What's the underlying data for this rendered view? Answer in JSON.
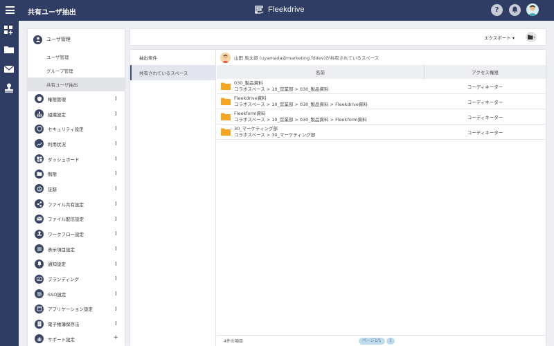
{
  "header": {
    "title": "共有ユーザ抽出",
    "brand": "Fleekdrive",
    "help_label": "?"
  },
  "menu": {
    "section_title": "ユーザ管理",
    "sub_items": [
      {
        "label": "ユーザ管理"
      },
      {
        "label": "グループ管理"
      },
      {
        "label": "共有ユーザ抽出"
      }
    ],
    "items": [
      {
        "label": "権限管理"
      },
      {
        "label": "組織設定"
      },
      {
        "label": "セキュリティ設定"
      },
      {
        "label": "利用状況"
      },
      {
        "label": "ダッシュボード"
      },
      {
        "label": "制限"
      },
      {
        "label": "証跡"
      },
      {
        "label": "ファイル共有設定"
      },
      {
        "label": "ファイル配信設定"
      },
      {
        "label": "ワークフロー設定"
      },
      {
        "label": "表示項目設定"
      },
      {
        "label": "通知設定"
      },
      {
        "label": "ブランディング"
      },
      {
        "label": "SSO設定"
      },
      {
        "label": "アプリケーション設定"
      },
      {
        "label": "電子帳簿保存法"
      },
      {
        "label": "サポート設定"
      }
    ]
  },
  "toolbar": {
    "export_label": "エクスポート ▾"
  },
  "tabs": [
    {
      "label": "抽出条件"
    },
    {
      "label": "共有されているスペース"
    }
  ],
  "panel": {
    "user_line": "山田 馬太郎 (uyamada@marketing.fddev)が共有されているスペース",
    "columns": {
      "name": "名前",
      "access": "アクセス権限"
    },
    "rows": [
      {
        "name": "030_製品資料",
        "path": "コラボスペース > 10_営業部 > 030_製品資料",
        "access": "コーディネーター"
      },
      {
        "name": "Fleekdrive資料",
        "path": "コラボスペース > 10_営業部 > 030_製品資料 > Fleekdrive資料",
        "access": "コーディネーター"
      },
      {
        "name": "Fleekform資料",
        "path": "コラボスペース > 10_営業部 > 030_製品資料 > Fleekform資料",
        "access": "コーディネーター"
      },
      {
        "name": "30_マーケティング部",
        "path": "コラボスペース > 30_マーケティング部",
        "access": "コーディネーター"
      }
    ],
    "footer": {
      "count": "4件の項目",
      "page_label": "ページ1/1",
      "page_number": "1"
    }
  },
  "colors": {
    "nav": "#2f3c63",
    "folder": "#f5a623",
    "accent_pill": "#bfdced"
  }
}
